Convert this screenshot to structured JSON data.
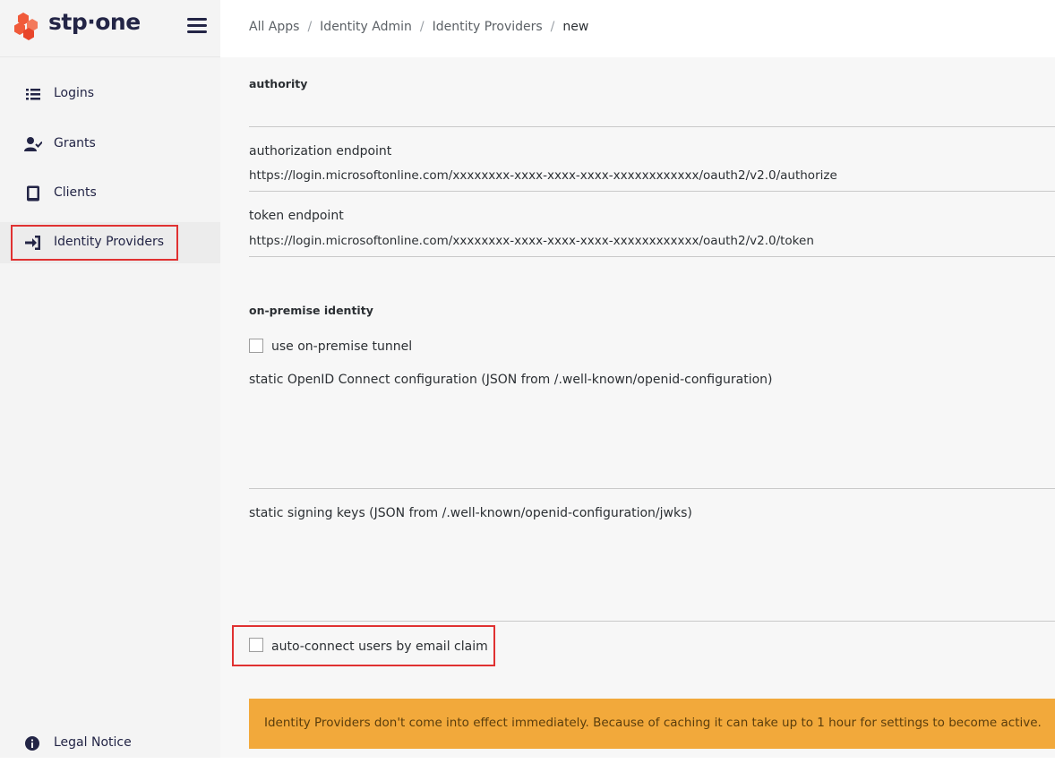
{
  "brand": {
    "name": "stp·one"
  },
  "sidebar": {
    "items": [
      {
        "label": "Logins",
        "icon": "list-icon"
      },
      {
        "label": "Grants",
        "icon": "user-check-icon"
      },
      {
        "label": "Clients",
        "icon": "tablet-icon"
      },
      {
        "label": "Identity Providers",
        "icon": "sign-in-icon",
        "active": true
      }
    ],
    "footer": {
      "label": "Legal Notice",
      "icon": "info-icon"
    }
  },
  "breadcrumb": {
    "items": [
      "All Apps",
      "Identity Admin",
      "Identity Providers"
    ],
    "current": "new"
  },
  "form": {
    "authority_section": "authority",
    "authorization_endpoint_label": "authorization endpoint",
    "authorization_endpoint_value": "https://login.microsoftonline.com/xxxxxxxx-xxxx-xxxx-xxxx-xxxxxxxxxxxx/oauth2/v2.0/authorize",
    "token_endpoint_label": "token endpoint",
    "token_endpoint_value": "https://login.microsoftonline.com/xxxxxxxx-xxxx-xxxx-xxxx-xxxxxxxxxxxx/oauth2/v2.0/token",
    "onprem_section": "on-premise identity",
    "tunnel_checkbox_label": "use on-premise tunnel",
    "static_config_label": "static OpenID Connect configuration (JSON from /.well-known/openid-configuration)",
    "static_keys_label": "static signing keys (JSON from /.well-known/openid-configuration/jwks)",
    "autoconnect_checkbox_label": "auto-connect users by email claim"
  },
  "notice": {
    "text": "Identity Providers don't come into effect immediately. Because of caching it can take up to 1 hour for settings to become active."
  },
  "colors": {
    "brand_accent": "#f05a3a",
    "brand_text": "#232546",
    "highlight": "#e03131",
    "notice_bg": "#f2a93b"
  }
}
